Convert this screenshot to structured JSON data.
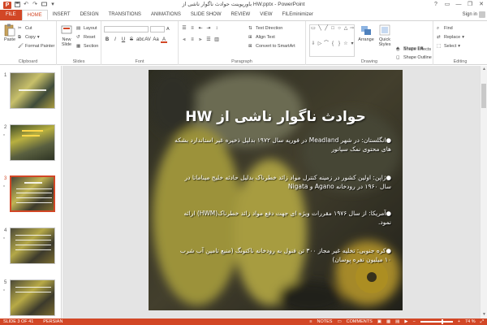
{
  "window": {
    "title": "باورپوینت حوادث ناگوار ناشی از HW.pptx - PowerPoint",
    "app_badge": "P",
    "minimize": "—",
    "restore": "❐",
    "close": "✕",
    "help": "?"
  },
  "tabs": [
    {
      "label": "FILE"
    },
    {
      "label": "HOME"
    },
    {
      "label": "INSERT"
    },
    {
      "label": "DESIGN"
    },
    {
      "label": "TRANSITIONS"
    },
    {
      "label": "ANIMATIONS"
    },
    {
      "label": "SLIDE SHOW"
    },
    {
      "label": "REVIEW"
    },
    {
      "label": "VIEW"
    },
    {
      "label": "FILEminimizer"
    }
  ],
  "signin": "Sign in",
  "ribbon": {
    "clipboard": {
      "paste": "Paste",
      "cut": "Cut",
      "copy": "Copy",
      "format_painter": "Format Painter",
      "label": "Clipboard"
    },
    "slides": {
      "new_slide": "New Slide",
      "layout": "Layout",
      "reset": "Reset",
      "section": "Section",
      "label": "Slides"
    },
    "font": {
      "label": "Font",
      "bold": "B",
      "italic": "I",
      "underline": "U",
      "strike": "S",
      "shadow": "abc",
      "spacing": "AV",
      "case": "Aa",
      "color": "A"
    },
    "paragraph": {
      "text_direction": "Text Direction",
      "align_text": "Align Text",
      "convert_smartart": "Convert to SmartArt",
      "label": "Paragraph"
    },
    "drawing": {
      "arrange": "Arrange",
      "quick_styles": "Quick Styles",
      "shape_fill": "Shape Fill",
      "shape_outline": "Shape Outline",
      "shape_effects": "Shape Effects",
      "label": "Drawing"
    },
    "editing": {
      "find": "Find",
      "replace": "Replace",
      "select": "Select",
      "label": "Editing"
    }
  },
  "thumbnails": [
    {
      "num": "1",
      "star": ""
    },
    {
      "num": "2",
      "star": "*"
    },
    {
      "num": "3",
      "star": "*"
    },
    {
      "num": "4",
      "star": "*"
    },
    {
      "num": "5",
      "star": "*"
    }
  ],
  "slide": {
    "title": "حوادث ناگوار ناشی از HW",
    "bullets": [
      "●انگلستان: در شهر Meadland در فوریه سال ۱۹۷۲ بدلیل ذخیره غیر استاندارد بشکه های محتوی نمک سیانور",
      "●ژاپن: اولین کشور در زمینه کنترل مواد زائد خطرناک بدلیل حادثه خلیج میناماتا در سال ۱۹۶۰ در رودخانه Agano و Nigata",
      "●آمریکا: از سال ۱۹۷۶ مقررات ویژه ای جهت دفع مواد زائد خطرناک(HWM) ارائه نمود.",
      "●کره جنوبی: تخلیه غیر مجاز ۳۰۰ تن فنول به رودخانه ناکتونگ (منبع تامین آب شرب ۱۰ میلیون نفره پوسان)"
    ]
  },
  "status": {
    "slide_info": "SLIDE 3 OF 41",
    "language": "PERSIAN",
    "notes": "NOTES",
    "comments": "COMMENTS",
    "zoom": "74 %"
  },
  "colors": {
    "accent": "#d24726",
    "editor_bg": "#e4e4e4"
  }
}
